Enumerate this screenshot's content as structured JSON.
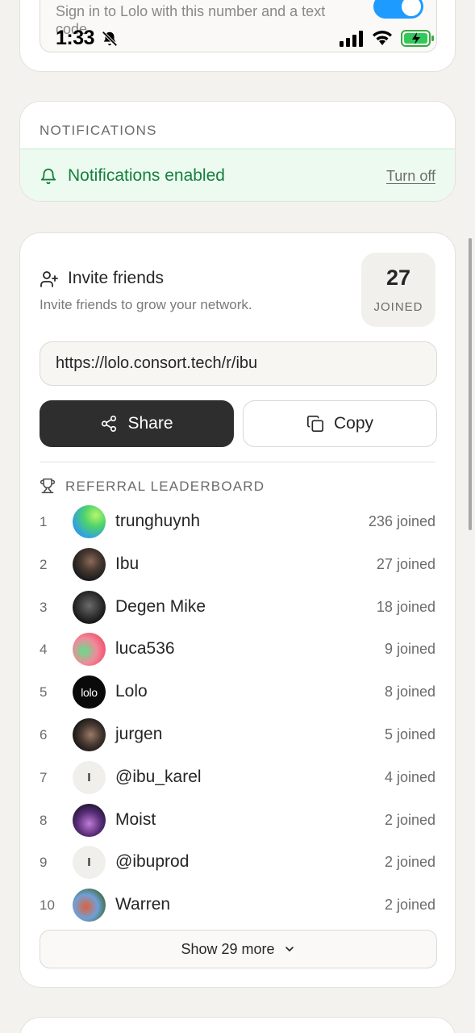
{
  "status_bar": {
    "time": "1:33"
  },
  "signin": {
    "description": "Sign in to Lolo with this number and a text code",
    "toggle_on": true
  },
  "notifications": {
    "section_title": "NOTIFICATIONS",
    "status_text": "Notifications enabled",
    "turn_off_label": "Turn off"
  },
  "invite": {
    "title": "Invite friends",
    "subtitle": "Invite friends to grow your network.",
    "joined_count": "27",
    "joined_label": "JOINED",
    "link": "https://lolo.consort.tech/r/ibu",
    "share_label": "Share",
    "copy_label": "Copy"
  },
  "leaderboard": {
    "title": "REFERRAL LEADERBOARD",
    "rows": [
      {
        "rank": "1",
        "name": "trunghuynh",
        "joined": "236 joined",
        "avatar": "gradient-green-blue"
      },
      {
        "rank": "2",
        "name": "Ibu",
        "joined": "27 joined",
        "avatar": "photo"
      },
      {
        "rank": "3",
        "name": "Degen Mike",
        "joined": "18 joined",
        "avatar": "photo"
      },
      {
        "rank": "4",
        "name": "luca536",
        "joined": "9 joined",
        "avatar": "gradient-red-green"
      },
      {
        "rank": "5",
        "name": "Lolo",
        "joined": "8 joined",
        "avatar": "logo",
        "avatar_text": "lolo"
      },
      {
        "rank": "6",
        "name": "jurgen",
        "joined": "5 joined",
        "avatar": "photo"
      },
      {
        "rank": "7",
        "name": "@ibu_karel",
        "joined": "4 joined",
        "avatar": "initial",
        "avatar_text": "I"
      },
      {
        "rank": "8",
        "name": "Moist",
        "joined": "2 joined",
        "avatar": "photo"
      },
      {
        "rank": "9",
        "name": "@ibuprod",
        "joined": "2 joined",
        "avatar": "initial",
        "avatar_text": "I"
      },
      {
        "rank": "10",
        "name": "Warren",
        "joined": "2 joined",
        "avatar": "photo"
      }
    ],
    "show_more_label": "Show 29 more"
  },
  "colors": {
    "background": "#f3f2ef",
    "accent_green": "#15803d",
    "toggle_blue": "#1e9bff",
    "share_button": "#2e2e2e"
  }
}
